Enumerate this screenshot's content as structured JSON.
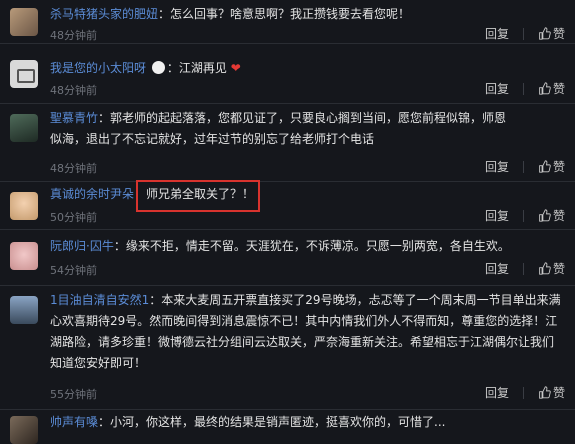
{
  "actions": {
    "reply": "回复",
    "like": "赞"
  },
  "comments": [
    {
      "user": "杀马特猪头家的肥妞",
      "text": "怎么回事？啥意思啊？我正攒钱要去看您呢！",
      "time": "48分钟前"
    },
    {
      "user": "我是您的小太阳呀",
      "text": "江湖再见",
      "time": "48分钟前"
    },
    {
      "user": "聖慕青竹",
      "text": "郭老师的起起落落，您都见证了，只要良心搁到当间，愿您前程似锦，师恩似海，退出了不忘记就好，过年过节的别忘了给老师打个电话",
      "time": "48分钟前"
    },
    {
      "user": "真诚的余时尹朵",
      "text": "师兄弟全取关了？！",
      "time": "50分钟前"
    },
    {
      "user": "阮郎归·囚牛",
      "text": "缘来不拒，情走不留。天涯犹在，不诉薄凉。只愿一别两宽，各自生欢。",
      "time": "54分钟前"
    },
    {
      "user": "1目油自清自安然1",
      "text": "本来大麦周五开票直接买了29号晚场，忐忑等了一个周末周一节目单出来满心欢喜期待29号。然而晚间得到消息震惊不已！其中内情我们外人不得而知，尊重您的选择！江湖路险，请多珍重！微博德云社分组间云达取关，严奈海重新关注。希望相忘于江湖偶尔让我们知道您安好即可！",
      "time": "55分钟前"
    },
    {
      "user": "帅声有嗓",
      "text": "小河，你这样，最终的结果是销声匿迹，挺喜欢你的，可惜了...",
      "time": ""
    }
  ],
  "colors": {
    "username": "#5b8cd6",
    "highlight": "#d8332e",
    "heart": "#e53935"
  }
}
